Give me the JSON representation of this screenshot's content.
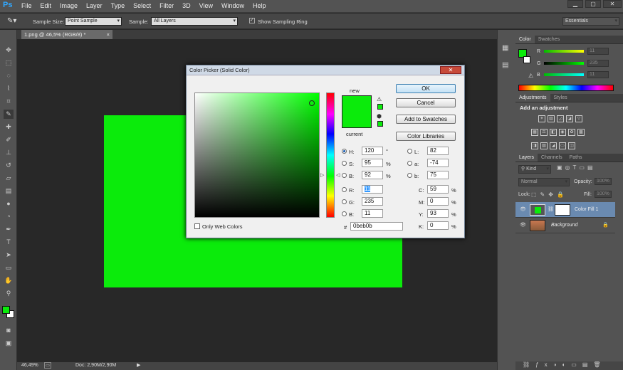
{
  "app": {
    "logo": "Ps"
  },
  "menubar": {
    "items": [
      "File",
      "Edit",
      "Image",
      "Layer",
      "Type",
      "Select",
      "Filter",
      "3D",
      "View",
      "Window",
      "Help"
    ]
  },
  "window_controls": {
    "minimize": "▁",
    "restore": "▢",
    "close": "✕"
  },
  "options_bar": {
    "sample_size_label": "Sample Size:",
    "sample_size_value": "Point Sample",
    "sample_label": "Sample:",
    "sample_value": "All Layers",
    "show_ring_label": "Show Sampling Ring",
    "workspace_value": "Essentials"
  },
  "document": {
    "tab_title": "1.png @ 46,5% (RGB/8) *",
    "tab_close": "×",
    "fill_color": "#0beb0b"
  },
  "status_bar": {
    "zoom": "46,49%",
    "doc_info": "Doc: 2,90M/2,90M"
  },
  "color_panel": {
    "tabs": [
      "Color",
      "Swatches"
    ],
    "r_label": "R",
    "g_label": "G",
    "b_label": "B",
    "r_value": "11",
    "g_value": "235",
    "b_value": "11"
  },
  "adjustments_panel": {
    "tabs": [
      "Adjustments",
      "Styles"
    ],
    "heading": "Add an adjustment"
  },
  "layers_panel": {
    "tabs": [
      "Layers",
      "Channels",
      "Paths"
    ],
    "filter_kind": "Kind",
    "blend_mode": "Normal",
    "opacity_label": "Opacity:",
    "opacity_value": "100%",
    "lock_label": "Lock:",
    "fill_label": "Fill:",
    "fill_value": "100%",
    "layers": [
      {
        "name": "Color Fill 1",
        "selected": true
      },
      {
        "name": "Background",
        "selected": false
      }
    ]
  },
  "color_picker": {
    "title": "Color Picker (Solid Color)",
    "new_label": "new",
    "current_label": "current",
    "color": "#0beb0b",
    "buttons": {
      "ok": "OK",
      "cancel": "Cancel",
      "add_swatches": "Add to Swatches",
      "libraries": "Color Libraries"
    },
    "hsb": [
      {
        "label": "H:",
        "value": "120",
        "unit": "°",
        "checked": true
      },
      {
        "label": "S:",
        "value": "95",
        "unit": "%",
        "checked": false
      },
      {
        "label": "B:",
        "value": "92",
        "unit": "%",
        "checked": false
      }
    ],
    "rgb": [
      {
        "label": "R:",
        "value": "11",
        "checked": false
      },
      {
        "label": "G:",
        "value": "235",
        "checked": false
      },
      {
        "label": "B:",
        "value": "11",
        "checked": false
      }
    ],
    "lab": [
      {
        "label": "L:",
        "value": "82"
      },
      {
        "label": "a:",
        "value": "-74"
      },
      {
        "label": "b:",
        "value": "75"
      }
    ],
    "cmyk": [
      {
        "label": "C:",
        "value": "59",
        "unit": "%"
      },
      {
        "label": "M:",
        "value": "0",
        "unit": "%"
      },
      {
        "label": "Y:",
        "value": "93",
        "unit": "%"
      },
      {
        "label": "K:",
        "value": "0",
        "unit": "%"
      }
    ],
    "hex_label": "#",
    "hex_value": "0beb0b",
    "only_web_colors": "Only Web Colors"
  }
}
